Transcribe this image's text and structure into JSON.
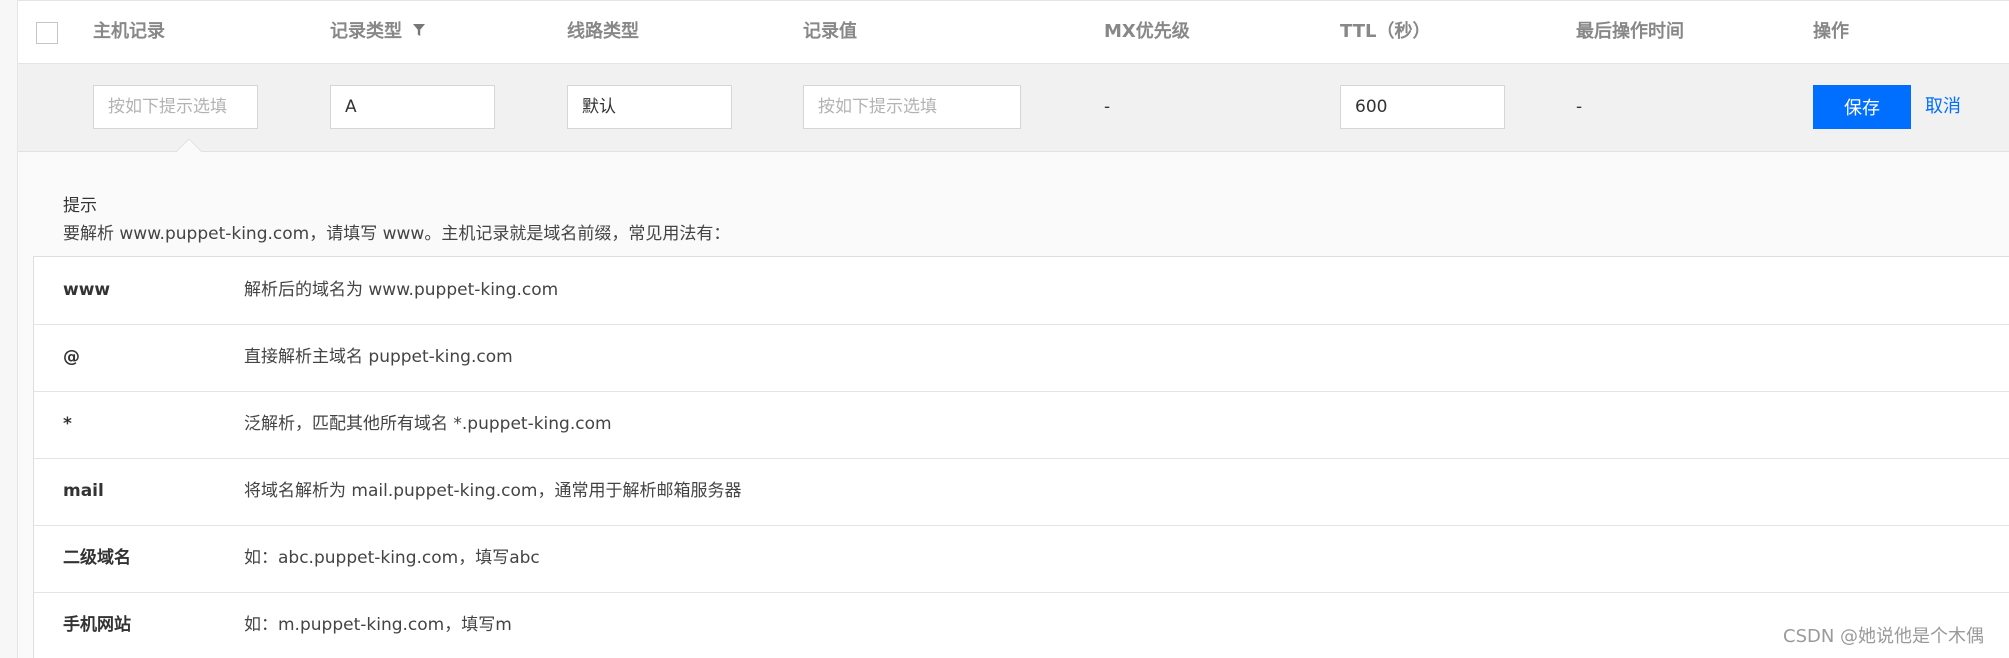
{
  "header": {
    "host": "主机记录",
    "type": "记录类型",
    "line": "线路类型",
    "value": "记录值",
    "mx": "MX优先级",
    "ttl": "TTL（秒）",
    "updated": "最后操作时间",
    "ops": "操作"
  },
  "edit_row": {
    "host_placeholder": "按如下提示选填",
    "type_value": "A",
    "line_value": "默认",
    "value_placeholder": "按如下提示选填",
    "mx": "-",
    "ttl_value": "600",
    "updated": "-",
    "save_label": "保存",
    "cancel_label": "取消"
  },
  "tips": {
    "title": "提示",
    "desc": "要解析 www.puppet-king.com，请填写 www。主机记录就是域名前缀，常见用法有：",
    "rows": [
      {
        "key": "www",
        "desc": "解析后的域名为 www.puppet-king.com"
      },
      {
        "key": "@",
        "desc": "直接解析主域名 puppet-king.com"
      },
      {
        "key": "*",
        "desc": "泛解析，匹配其他所有域名 *.puppet-king.com"
      },
      {
        "key": "mail",
        "desc": "将域名解析为 mail.puppet-king.com，通常用于解析邮箱服务器"
      },
      {
        "key": "二级域名",
        "desc": "如：abc.puppet-king.com，填写abc"
      },
      {
        "key": "手机网站",
        "desc": "如：m.puppet-king.com，填写m"
      }
    ]
  },
  "icons": [
    "checkbox-icon",
    "filter-icon"
  ],
  "colors": {
    "primary": "#006eff",
    "header_text": "#888888"
  },
  "watermark": "CSDN @她说他是个木偶"
}
